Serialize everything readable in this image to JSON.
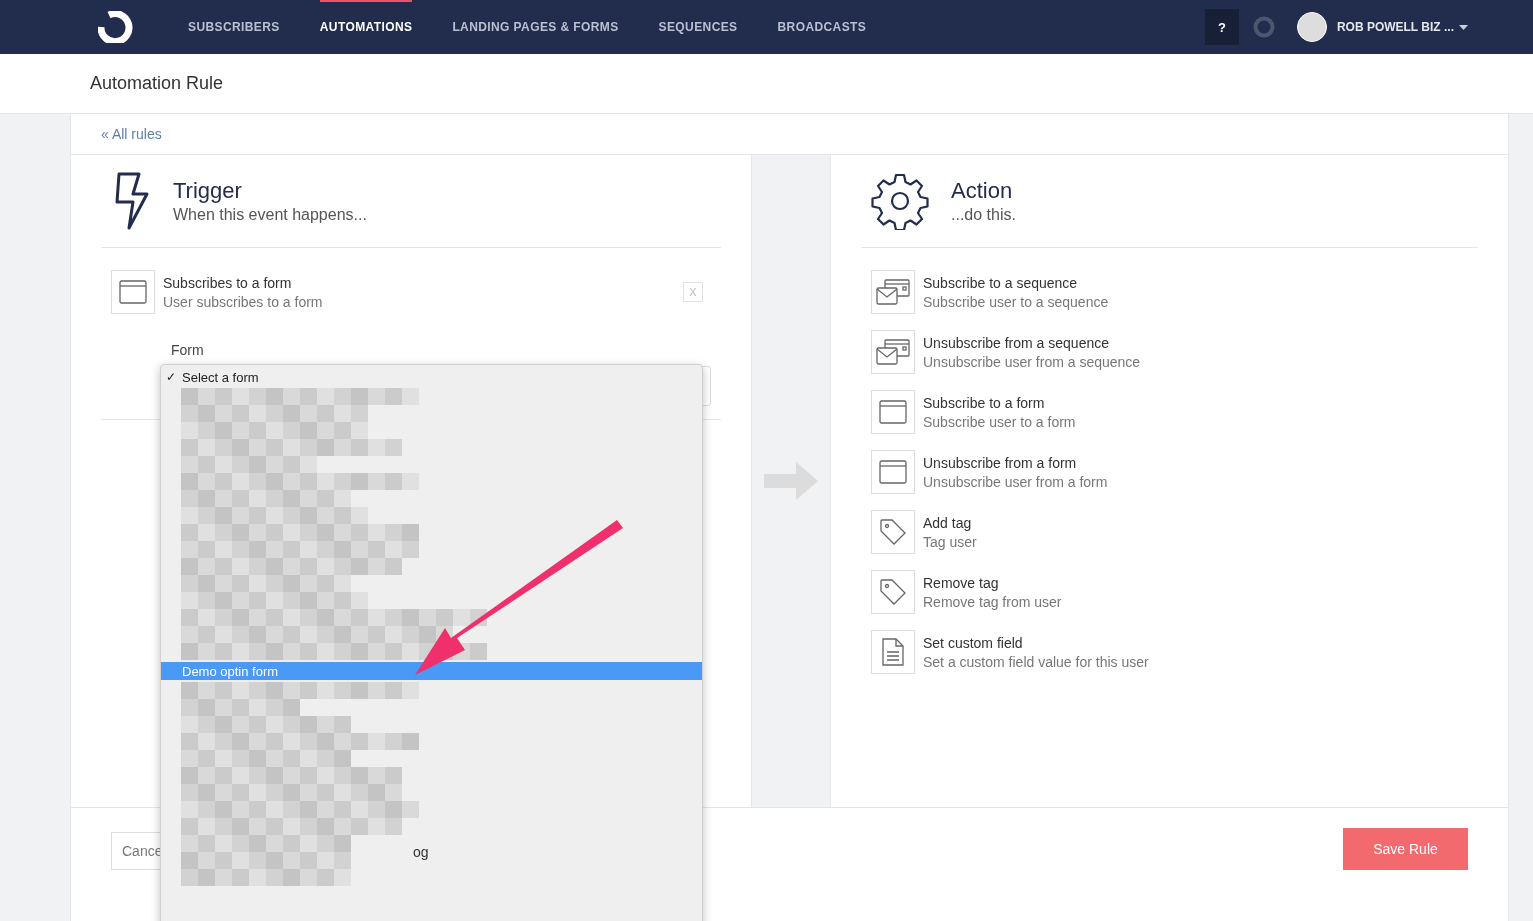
{
  "nav": {
    "items": [
      {
        "label": "SUBSCRIBERS",
        "selected": false
      },
      {
        "label": "AUTOMATIONS",
        "selected": true
      },
      {
        "label": "LANDING PAGES & FORMS",
        "selected": false
      },
      {
        "label": "SEQUENCES",
        "selected": false
      },
      {
        "label": "BROADCASTS",
        "selected": false
      }
    ],
    "help": "?",
    "account": "ROB POWELL BIZ ..."
  },
  "page_title": "Automation Rule",
  "back_link": "« All rules",
  "trigger": {
    "title": "Trigger",
    "subtitle": "When this event happens...",
    "item": {
      "kind": "form",
      "title": "Subscribes to a form",
      "description": "User subscribes to a form",
      "remove": "X"
    },
    "form_label": "Form"
  },
  "action": {
    "title": "Action",
    "subtitle": "...do this.",
    "items": [
      {
        "kind": "sequence",
        "title": "Subscribe to a sequence",
        "description": "Subscribe user to a sequence"
      },
      {
        "kind": "sequence",
        "title": "Unsubscribe from a sequence",
        "description": "Unsubscribe user from a sequence"
      },
      {
        "kind": "form",
        "title": "Subscribe to a form",
        "description": "Subscribe user to a form"
      },
      {
        "kind": "form",
        "title": "Unsubscribe from a form",
        "description": "Unsubscribe user from a form"
      },
      {
        "kind": "tag",
        "title": "Add tag",
        "description": "Tag user"
      },
      {
        "kind": "tag",
        "title": "Remove tag",
        "description": "Remove tag from user"
      },
      {
        "kind": "field",
        "title": "Set custom field",
        "description": "Set a custom field value for this user"
      }
    ]
  },
  "footer": {
    "cancel": "Cance",
    "save": "Save Rule"
  },
  "dropdown": {
    "options": [
      {
        "label": "Select a form",
        "checked": true,
        "selected": false
      },
      {
        "label": "Demo optin form",
        "checked": false,
        "selected": true
      }
    ],
    "check_mark": "✓",
    "fragment": "og"
  }
}
